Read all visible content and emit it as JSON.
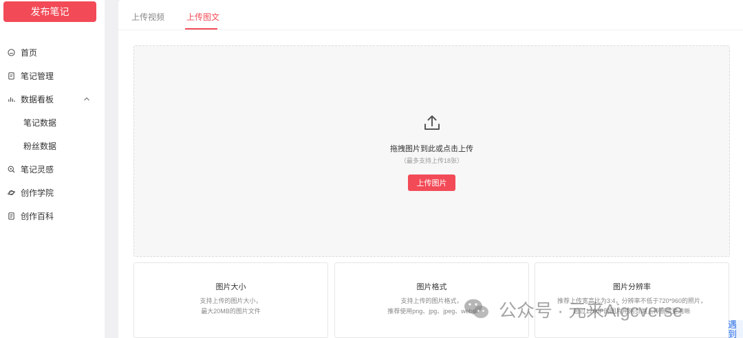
{
  "sidebar": {
    "publish_label": "发布笔记",
    "items": [
      {
        "label": "首页",
        "icon": "home-icon"
      },
      {
        "label": "笔记管理",
        "icon": "note-icon"
      },
      {
        "label": "数据看板",
        "icon": "bar-chart-icon",
        "expanded": true
      },
      {
        "label": "笔记数据"
      },
      {
        "label": "粉丝数据"
      },
      {
        "label": "笔记灵感",
        "icon": "lightbulb-search-icon"
      },
      {
        "label": "创作学院",
        "icon": "planet-icon"
      },
      {
        "label": "创作百科",
        "icon": "book-icon"
      }
    ]
  },
  "tabs": {
    "video": "上传视频",
    "image": "上传图文"
  },
  "upload": {
    "title": "拖拽图片到此或点击上传",
    "subtitle": "（最多支持上传18张）",
    "button": "上传图片"
  },
  "cards": [
    {
      "title": "图片大小",
      "line1": "支持上传的图片大小，",
      "line2": "最大20MB的图片文件"
    },
    {
      "title": "图片格式",
      "line1": "支持上传的图片格式，",
      "line2": "推荐使用png、jpg、jpeg、webp"
    },
    {
      "title": "图片分辨率",
      "line1": "推荐上传宽高比为3:4，分辨率不低于720*960的照片，",
      "line2": "超过1280P的图片用网页端上传画质更清晰"
    }
  ],
  "watermark": {
    "text": "公众号 · 元来Aigcverse"
  },
  "corner": {
    "text": "遇到问题"
  },
  "colors": {
    "accent": "#f24b57",
    "background": "#f0f0f2"
  }
}
